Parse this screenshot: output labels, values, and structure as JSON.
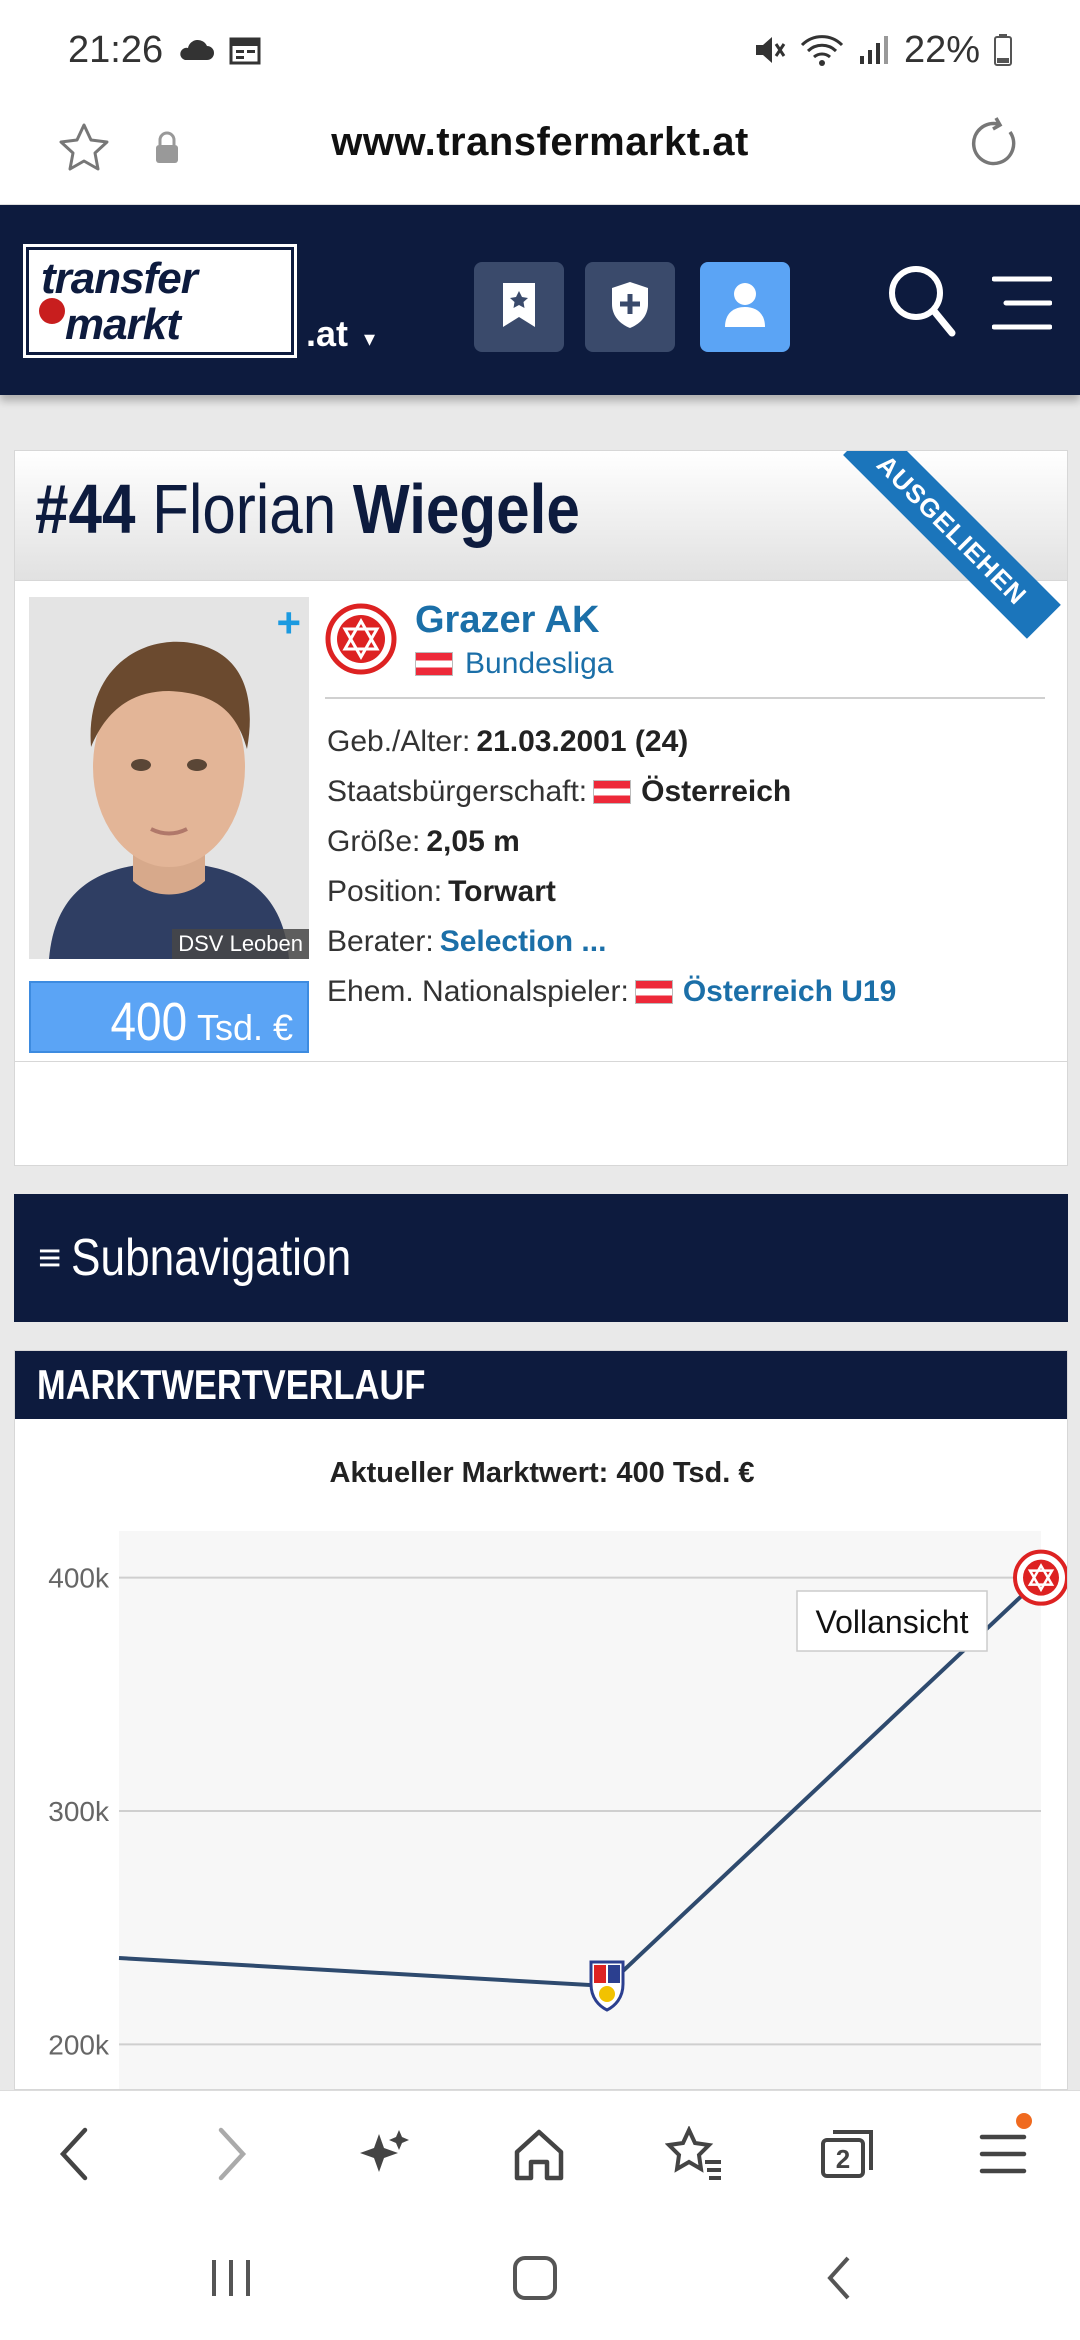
{
  "status_bar": {
    "time": "21:26",
    "battery": "22%",
    "icons": [
      "cloud-icon",
      "calendar-icon",
      "mute-icon",
      "wifi-icon",
      "signal-icon",
      "battery-icon"
    ]
  },
  "browser": {
    "url": "www.transfermarkt.at",
    "icons": [
      "star-icon",
      "lock-icon",
      "reload-icon"
    ]
  },
  "site_header": {
    "logo_line1": "transfer",
    "logo_line2": "markt",
    "tld": ".at",
    "buttons": [
      "bookmark-icon",
      "shield-plus-icon",
      "user-icon"
    ],
    "active_button": "user-icon",
    "colors": {
      "header_bg": "#0d1b3e",
      "active": "#5ba4f5"
    }
  },
  "player": {
    "number": "#44",
    "first_name": "Florian",
    "last_name": "Wiegele",
    "ribbon": "AUSGELIEHEN",
    "photo_plus": "+",
    "photo_club_label": "DSV Leoben",
    "market_value": "400",
    "market_value_unit": "Tsd. €",
    "club": "Grazer AK",
    "league": "Bundesliga",
    "info": [
      {
        "label": "Geb./Alter:",
        "value": "21.03.2001 (24)",
        "flag": false,
        "link": false
      },
      {
        "label": "Staatsbürgerschaft:",
        "value": "Österreich",
        "flag": true,
        "link": false
      },
      {
        "label": "Größe:",
        "value": "2,05 m",
        "flag": false,
        "link": false
      },
      {
        "label": "Position:",
        "value": "Torwart",
        "flag": false,
        "link": false
      },
      {
        "label": "Berater:",
        "value": "Selection ...",
        "flag": false,
        "link": true
      },
      {
        "label": "Ehem. Nationalspieler:",
        "value": "Österreich U19",
        "flag": true,
        "link": true
      }
    ]
  },
  "subnav": {
    "icon": "≡",
    "label": "Subnavigation"
  },
  "market_value_section": {
    "title": "MARKTWERTVERLAUF",
    "caption": "Aktueller Marktwert: 400 Tsd. €",
    "button": "Vollansicht"
  },
  "chart_data": {
    "type": "line",
    "title": "Aktueller Marktwert: 400 Tsd. €",
    "xlabel": "",
    "ylabel": "",
    "ylim": [
      180000,
      420000
    ],
    "ytick_values": [
      200000,
      300000,
      400000
    ],
    "yticks": [
      "200k",
      "300k",
      "400k"
    ],
    "grid": true,
    "series": [
      {
        "values": [
          237000,
          225000,
          400000
        ],
        "markers": [
          "",
          "club-crest-icon",
          "grazer-ak-crest-icon"
        ]
      }
    ],
    "colors": {
      "line": "#2e4a6e",
      "grid": "#cfcfcf",
      "plot_bg": "#f7f7f7"
    }
  },
  "bottom_nav": {
    "tab_count": "2",
    "icons": [
      "back-icon",
      "forward-icon",
      "sparkle-icon",
      "home-icon",
      "bookmarks-icon",
      "tabs-icon",
      "menu-icon"
    ]
  },
  "system_nav": {
    "icons": [
      "recents-icon",
      "home-button-icon",
      "back-gesture-icon"
    ]
  }
}
